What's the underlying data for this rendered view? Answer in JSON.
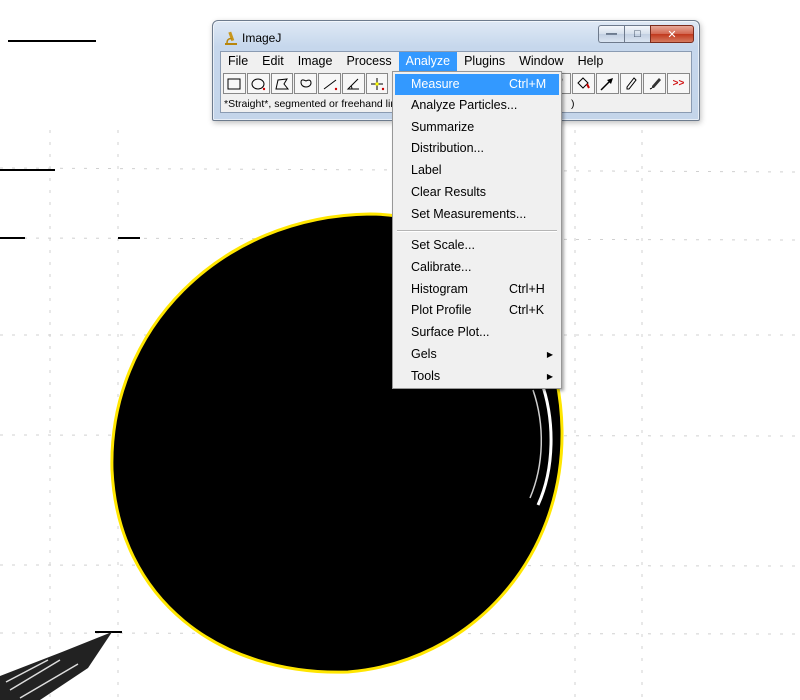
{
  "window": {
    "title": "ImageJ",
    "min_glyph": "—",
    "max_glyph": "□",
    "close_glyph": "✕"
  },
  "menubar": [
    "File",
    "Edit",
    "Image",
    "Process",
    "Analyze",
    "Plugins",
    "Window",
    "Help"
  ],
  "active_menu": "Analyze",
  "toolbar": {
    "left_tools": [
      "rectangle-tool",
      "oval-tool",
      "polygon-tool",
      "freehand-tool",
      "line-tool",
      "angle-tool",
      "point-tool"
    ],
    "right_tools": [
      "brush-tool",
      "flood-fill-tool",
      "arrow-tool",
      "pencil-tool",
      "dropper-tool"
    ],
    "more_label": ">>"
  },
  "status": {
    "text": "*Straight*, segmented or freehand lines, or arrows",
    "tail": ")"
  },
  "analyze_menu": {
    "group1": [
      {
        "label": "Measure",
        "shortcut": "Ctrl+M",
        "selected": true
      },
      {
        "label": "Analyze Particles...",
        "shortcut": ""
      },
      {
        "label": "Summarize",
        "shortcut": ""
      },
      {
        "label": "Distribution...",
        "shortcut": ""
      },
      {
        "label": "Label",
        "shortcut": ""
      },
      {
        "label": "Clear Results",
        "shortcut": ""
      },
      {
        "label": "Set Measurements...",
        "shortcut": ""
      }
    ],
    "group2": [
      {
        "label": "Set Scale...",
        "shortcut": ""
      },
      {
        "label": "Calibrate...",
        "shortcut": ""
      },
      {
        "label": "Histogram",
        "shortcut": "Ctrl+H"
      },
      {
        "label": "Plot Profile",
        "shortcut": "Ctrl+K"
      },
      {
        "label": "Surface Plot...",
        "shortcut": ""
      },
      {
        "label": "Gels",
        "shortcut": "",
        "submenu": true
      },
      {
        "label": "Tools",
        "shortcut": "",
        "submenu": true
      }
    ]
  },
  "colors": {
    "menu_highlight": "#3399ff",
    "selection_outline": "#ffe600",
    "blob": "#000000"
  }
}
